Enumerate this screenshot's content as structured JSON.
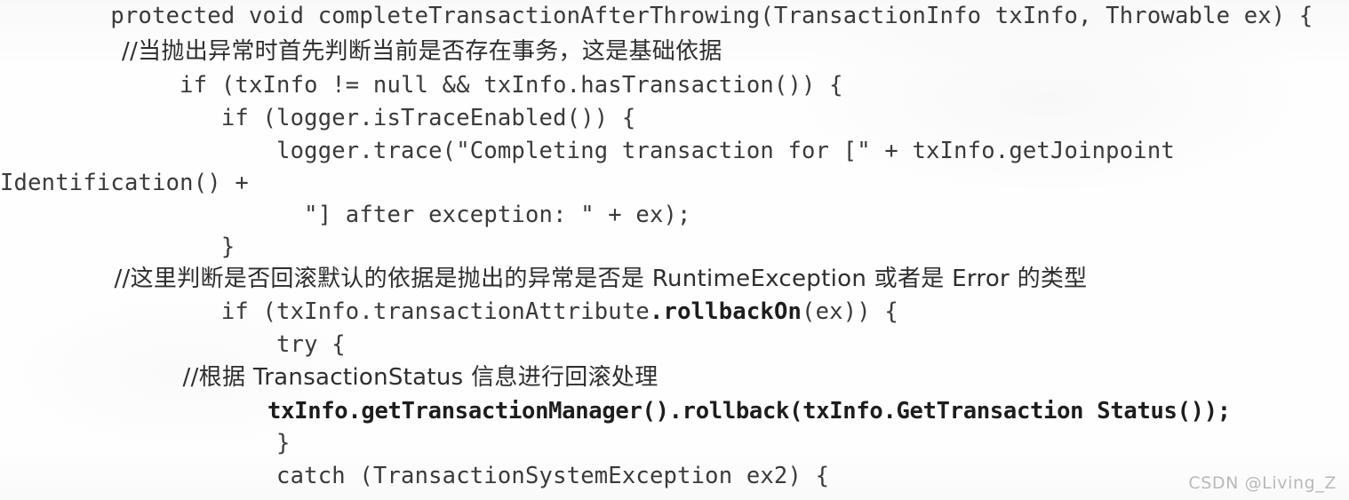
{
  "document": {
    "kind": "scanned-code-listing",
    "language": "java",
    "background_color": "#fefefe",
    "text_color": "#3a3a3c",
    "bold_text_color": "#1d1d1f",
    "watermark_color": "#b9b9bd"
  },
  "code": {
    "lines": [
      {
        "indent": 0,
        "text": "        protected void completeTransactionAfterThrowing(TransactionInfo txInfo, Throwable ex) {",
        "style": "mono"
      },
      {
        "indent": 0,
        "text": "                //当抛出异常时首先判断当前是否存在事务，这是基础依据",
        "style": "cjk"
      },
      {
        "indent": 0,
        "text": "             if (txInfo != null && txInfo.hasTransaction()) {",
        "style": "mono"
      },
      {
        "indent": 0,
        "text": "                if (logger.isTraceEnabled()) {",
        "style": "mono"
      },
      {
        "indent": 0,
        "text": "                    logger.trace(\"Completing transaction for [\" + txInfo.getJoinpoint",
        "style": "mono"
      },
      {
        "indent": 0,
        "text": "Identification() +",
        "style": "mono"
      },
      {
        "indent": 0,
        "text": "                      \"] after exception: \" + ex);",
        "style": "mono"
      },
      {
        "indent": 0,
        "text": "                }",
        "style": "mono"
      },
      {
        "indent": 0,
        "text": "               //这里判断是否回滚默认的依据是抛出的异常是否是 RuntimeException 或者是 Error 的类型",
        "style": "cjk"
      },
      {
        "indent": 0,
        "text": "                if (txInfo.transactionAttribute.rollbackOn(ex)) {",
        "style": "mono",
        "bold_segment": ".rollbackOn"
      },
      {
        "indent": 0,
        "text": "                    try {",
        "style": "mono"
      },
      {
        "indent": 0,
        "text": "                        //根据 TransactionStatus 信息进行回滚处理",
        "style": "cjk"
      },
      {
        "indent": 0,
        "text": "                    txInfo.getTransactionManager().rollback(txInfo.GetTransaction Status());",
        "style": "bold"
      },
      {
        "indent": 0,
        "text": "                    }",
        "style": "mono"
      },
      {
        "indent": 0,
        "text": "                    catch (TransactionSystemException ex2) {",
        "style": "mono"
      }
    ]
  },
  "watermark": {
    "label": "CSDN @Living_Z"
  },
  "ghost_stamp": {
    "label": ""
  }
}
